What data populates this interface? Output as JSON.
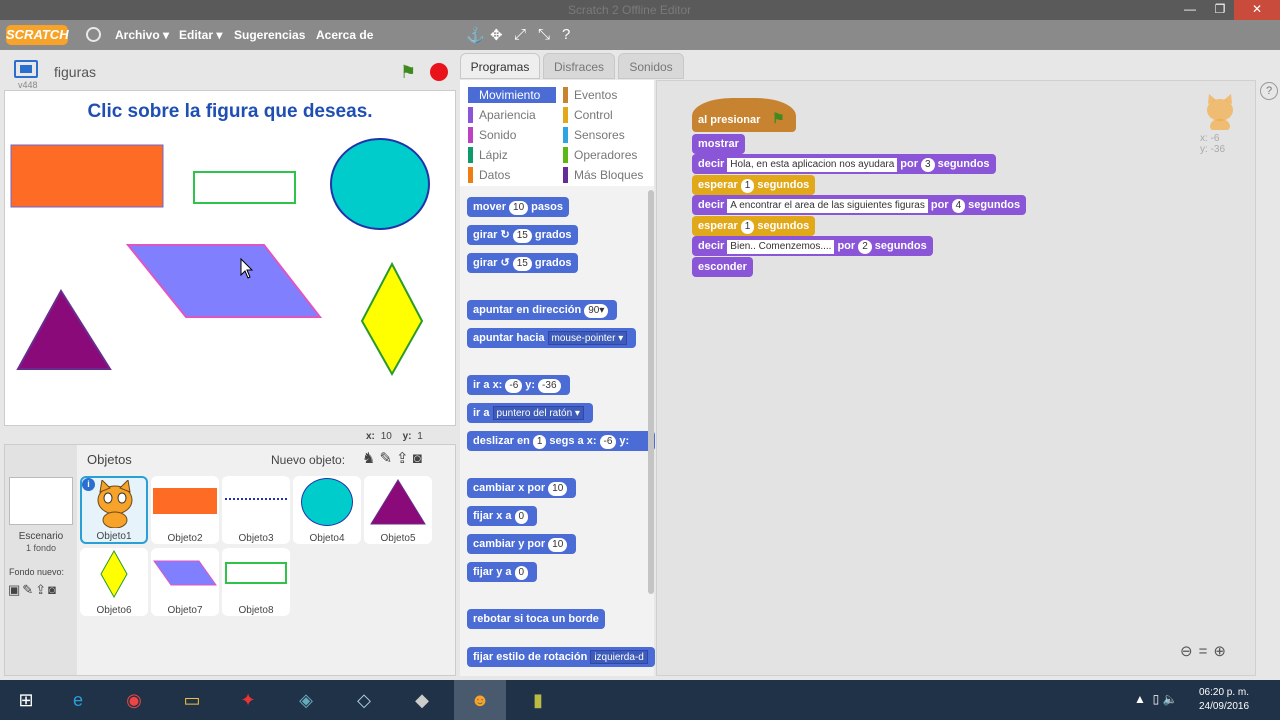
{
  "window": {
    "title": "Scratch 2 Offline Editor"
  },
  "menubar": {
    "logo": "SCRATCH",
    "items": [
      "Archivo ▾",
      "Editar ▾",
      "Sugerencias",
      "Acerca de"
    ]
  },
  "stage": {
    "project_name": "figuras",
    "version": "v448",
    "text": "Clic sobre la figura que deseas.",
    "mouse_x_label": "x:",
    "mouse_x": "10",
    "mouse_y_label": "y:",
    "mouse_y": "1"
  },
  "sprites_pane": {
    "title": "Objetos",
    "new_sprite_label": "Nuevo objeto:",
    "stage_label": "Escenario",
    "stage_sub": "1 fondo",
    "new_backdrop_label": "Fondo nuevo:",
    "sprites": [
      "Objeto1",
      "Objeto2",
      "Objeto3",
      "Objeto4",
      "Objeto5",
      "Objeto6",
      "Objeto7",
      "Objeto8"
    ],
    "selected": "Objeto1"
  },
  "tabs": [
    "Programas",
    "Disfraces",
    "Sonidos"
  ],
  "active_tab": "Programas",
  "categories": [
    {
      "label": "Movimiento",
      "color": "#4a6cd4"
    },
    {
      "label": "Eventos",
      "color": "#c88330"
    },
    {
      "label": "Apariencia",
      "color": "#8a55d7"
    },
    {
      "label": "Control",
      "color": "#e1a91a"
    },
    {
      "label": "Sonido",
      "color": "#bb42c3"
    },
    {
      "label": "Sensores",
      "color": "#2ca5e2"
    },
    {
      "label": "Lápiz",
      "color": "#0e9a6c"
    },
    {
      "label": "Operadores",
      "color": "#5cb712"
    },
    {
      "label": "Datos",
      "color": "#ee7d16"
    },
    {
      "label": "Más Bloques",
      "color": "#632d99"
    }
  ],
  "palette": {
    "mover": {
      "a": "mover",
      "n": "10",
      "b": "pasos"
    },
    "girar_r": {
      "a": "girar ↻",
      "n": "15",
      "b": "grados"
    },
    "girar_l": {
      "a": "girar ↺",
      "n": "15",
      "b": "grados"
    },
    "apuntar_dir": {
      "a": "apuntar en dirección",
      "n": "90▾"
    },
    "apuntar_hacia": {
      "a": "apuntar hacia",
      "d": "mouse-pointer ▾"
    },
    "ir_a_xy": {
      "a": "ir a x:",
      "x": "-6",
      "b": "y:",
      "y": "-36"
    },
    "ir_a": {
      "a": "ir a",
      "d": "puntero del ratón ▾"
    },
    "deslizar": {
      "a": "deslizar en",
      "n": "1",
      "b": "segs a x:",
      "x": "-6",
      "c": "y:"
    },
    "cambiar_x": {
      "a": "cambiar x por",
      "n": "10"
    },
    "fijar_x": {
      "a": "fijar x a",
      "n": "0"
    },
    "cambiar_y": {
      "a": "cambiar y por",
      "n": "10"
    },
    "fijar_y": {
      "a": "fijar y a",
      "n": "0"
    },
    "rebotar": {
      "a": "rebotar si toca un borde"
    },
    "fijar_estilo": {
      "a": "fijar estilo de rotación",
      "d": "izquierda-d"
    }
  },
  "script": {
    "hat": "al presionar",
    "mostrar": "mostrar",
    "say1": {
      "a": "decir",
      "t": "Hola, en esta aplicacion nos ayudara",
      "b": "por",
      "n": "3",
      "c": "segundos"
    },
    "wait1": {
      "a": "esperar",
      "n": "1",
      "b": "segundos"
    },
    "say2": {
      "a": "decir",
      "t": "A encontrar el area de las siguientes figuras",
      "b": "por",
      "n": "4",
      "c": "segundos"
    },
    "wait2": {
      "a": "esperar",
      "n": "1",
      "b": "segundos"
    },
    "say3": {
      "a": "decir",
      "t": "Bien.. Comenzemos....",
      "b": "por",
      "n": "2",
      "c": "segundos"
    },
    "esconder": "esconder"
  },
  "sprite_info": {
    "x": "x: -6",
    "y": "y: -36"
  },
  "taskbar": {
    "time": "06:20 p. m.",
    "date": "24/09/2016"
  }
}
